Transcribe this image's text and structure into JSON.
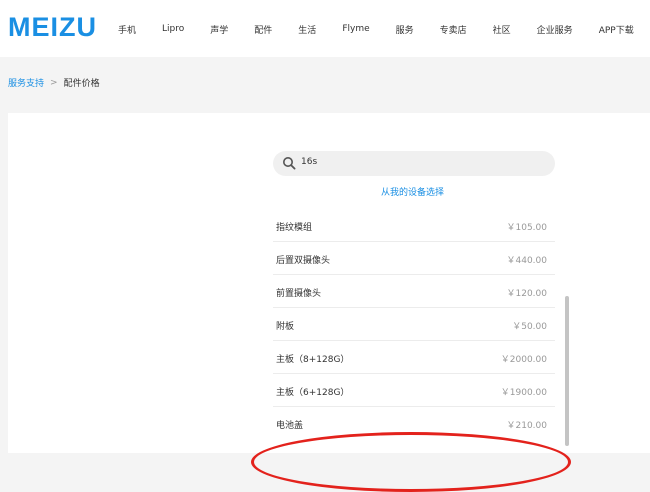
{
  "header": {
    "logo": "MEIZU",
    "nav": [
      "手机",
      "Lipro",
      "声学",
      "配件",
      "生活",
      "Flyme",
      "服务",
      "专卖店",
      "社区",
      "企业服务",
      "APP下载"
    ]
  },
  "breadcrumb": {
    "parent": "服务支持",
    "separator": ">",
    "current": "配件价格"
  },
  "search": {
    "value": "16s"
  },
  "device_select_label": "从我的设备选择",
  "parts": [
    {
      "name": "指纹模组",
      "price": "￥105.00"
    },
    {
      "name": "后置双摄像头",
      "price": "￥440.00"
    },
    {
      "name": "前置摄像头",
      "price": "￥120.00"
    },
    {
      "name": "附板",
      "price": "￥50.00"
    },
    {
      "name": "主板（8+128G）",
      "price": "￥2000.00"
    },
    {
      "name": "主板（6+128G）",
      "price": "￥1900.00"
    },
    {
      "name": "电池盖",
      "price": "￥210.00"
    }
  ],
  "colors": {
    "brand": "#1a8fe3",
    "annotation": "#e3221c"
  }
}
